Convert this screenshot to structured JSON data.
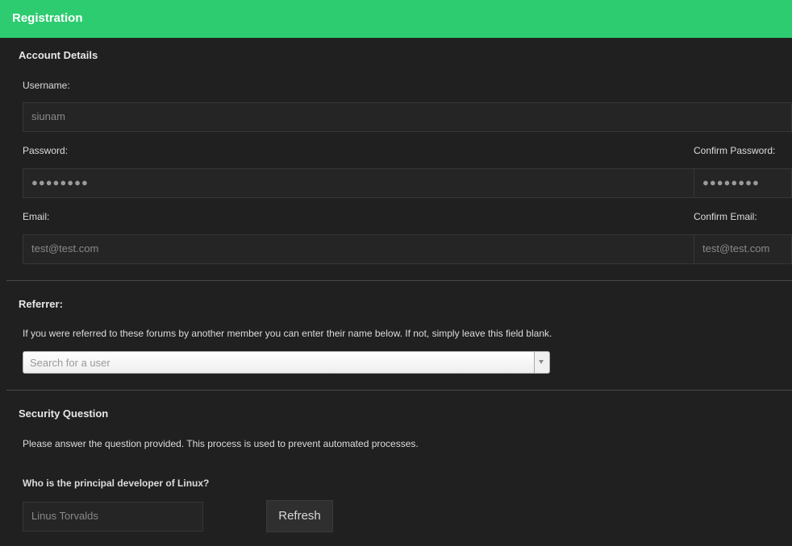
{
  "header": {
    "title": "Registration"
  },
  "account": {
    "title": "Account Details",
    "username_label": "Username:",
    "username_value": "siunam",
    "password_label": "Password:",
    "password_value": "●●●●●●●●",
    "confirm_password_label": "Confirm Password:",
    "confirm_password_value": "●●●●●●●●",
    "email_label": "Email:",
    "email_value": "test@test.com",
    "confirm_email_label": "Confirm Email:",
    "confirm_email_value": "test@test.com"
  },
  "referrer": {
    "title": "Referrer:",
    "description": "If you were referred to these forums by another member you can enter their name below. If not, simply leave this field blank.",
    "placeholder": "Search for a user"
  },
  "security": {
    "title": "Security Question",
    "description": "Please answer the question provided. This process is used to prevent automated processes.",
    "question": "Who is the principal developer of Linux?",
    "answer_value": "Linus Torvalds",
    "refresh_label": "Refresh"
  },
  "colors": {
    "header_bg": "#2ecc71",
    "page_bg": "#202020"
  }
}
